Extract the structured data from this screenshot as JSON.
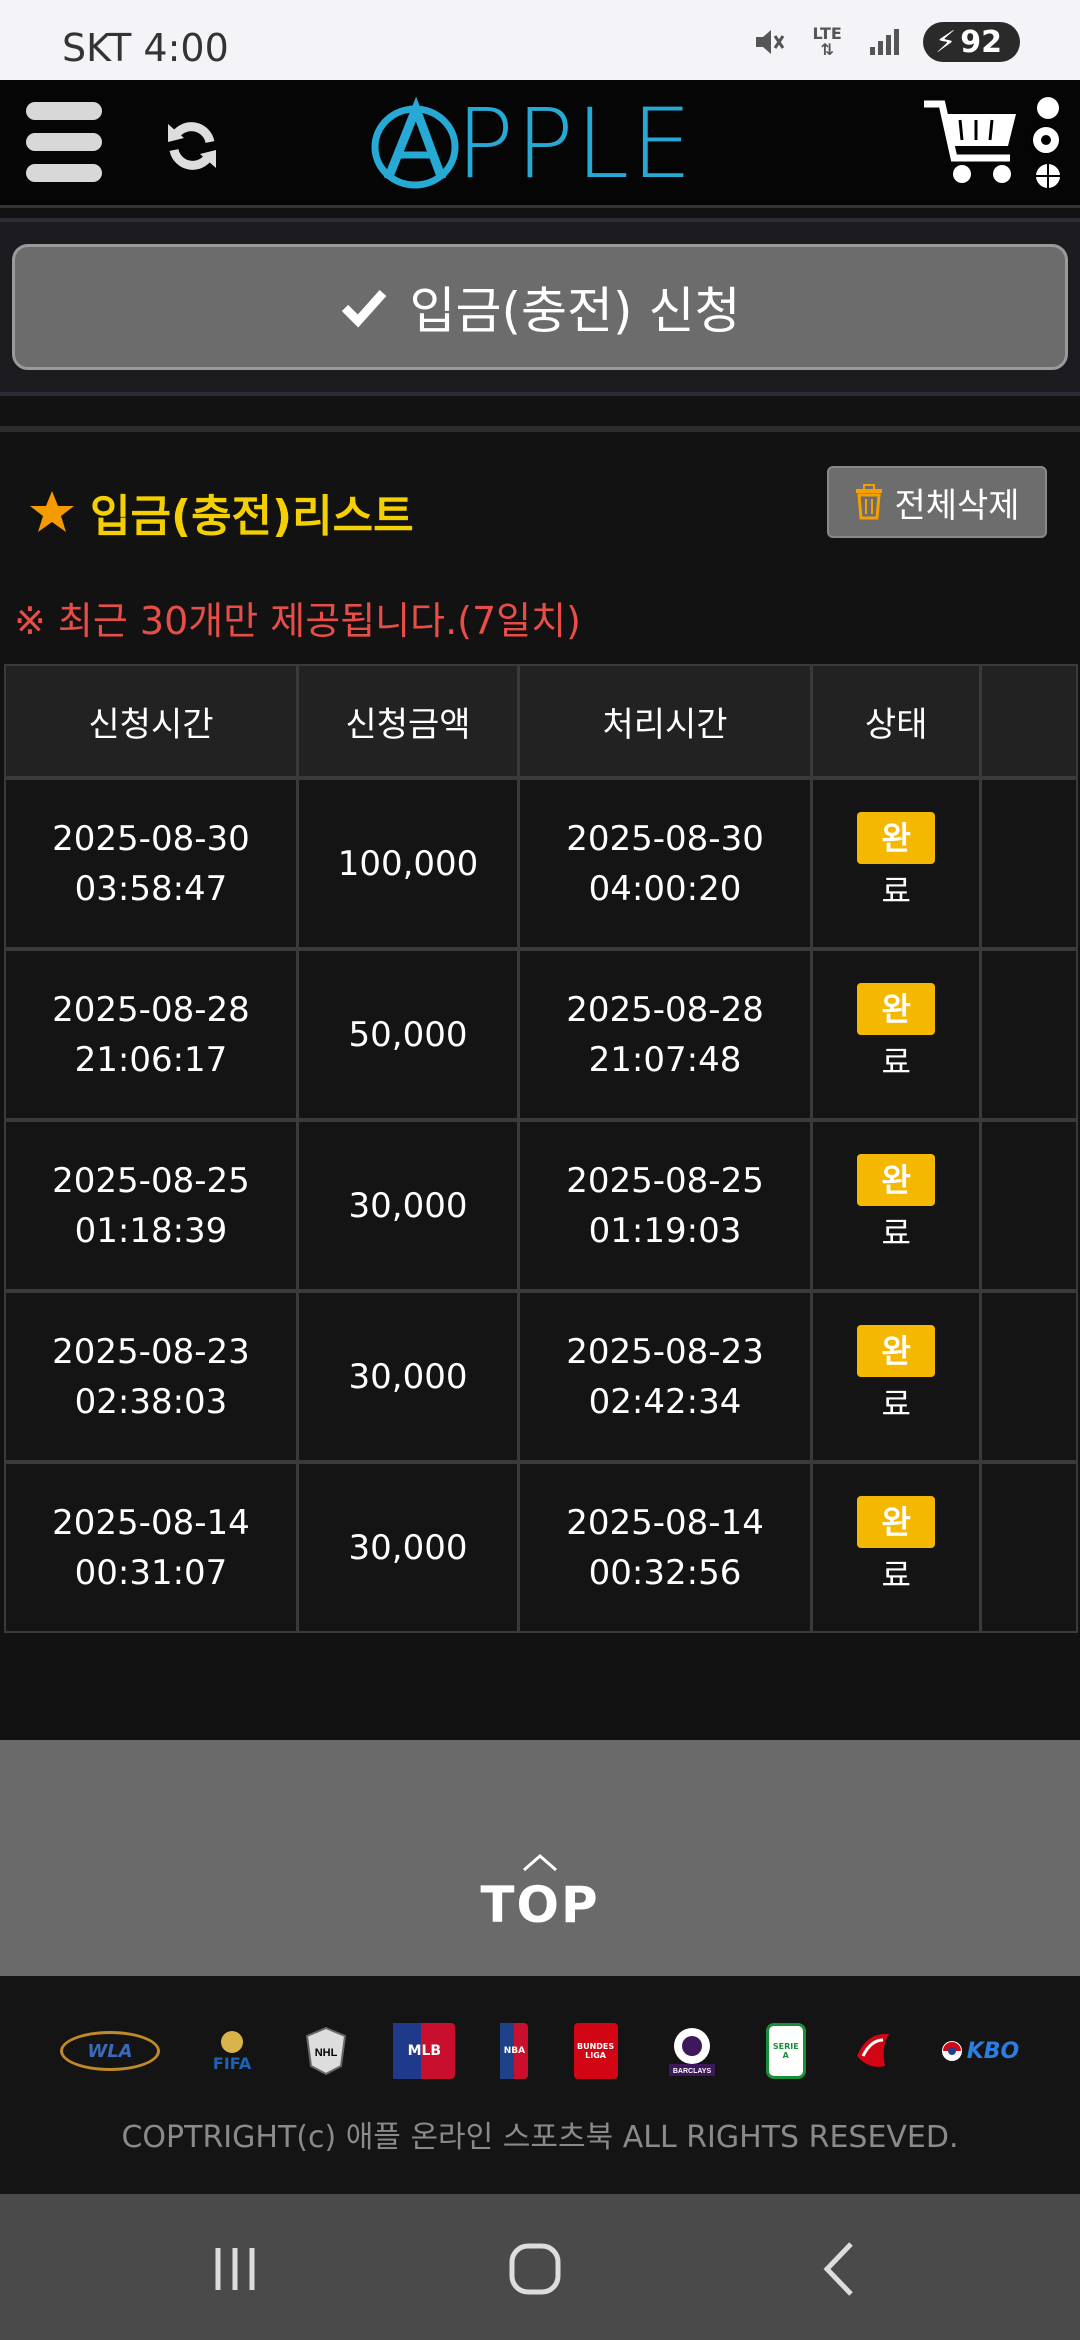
{
  "status_bar": {
    "carrier": "SKT",
    "time": "4:00",
    "network": "LTE",
    "battery": "92"
  },
  "header": {
    "logo_text": "PPLE"
  },
  "apply": {
    "label": "입금(충전) 신청"
  },
  "list": {
    "title": "입금(충전)리스트",
    "delete_all": "전체삭제",
    "notice": "※ 최근 30개만 제공됩니다.(7일치)",
    "columns": [
      "신청시간",
      "신청금액",
      "처리시간",
      "상태",
      ""
    ],
    "rows": [
      {
        "req_date": "2025-08-30",
        "req_time": "03:58:47",
        "amount": "100,000",
        "proc_date": "2025-08-30",
        "proc_time": "04:00:20",
        "status_1": "완",
        "status_2": "료"
      },
      {
        "req_date": "2025-08-28",
        "req_time": "21:06:17",
        "amount": "50,000",
        "proc_date": "2025-08-28",
        "proc_time": "21:07:48",
        "status_1": "완",
        "status_2": "료"
      },
      {
        "req_date": "2025-08-25",
        "req_time": "01:18:39",
        "amount": "30,000",
        "proc_date": "2025-08-25",
        "proc_time": "01:19:03",
        "status_1": "완",
        "status_2": "료"
      },
      {
        "req_date": "2025-08-23",
        "req_time": "02:38:03",
        "amount": "30,000",
        "proc_date": "2025-08-23",
        "proc_time": "02:42:34",
        "status_1": "완",
        "status_2": "료"
      },
      {
        "req_date": "2025-08-14",
        "req_time": "00:31:07",
        "amount": "30,000",
        "proc_date": "2025-08-14",
        "proc_time": "00:32:56",
        "status_1": "완",
        "status_2": "료"
      }
    ]
  },
  "top_button": {
    "label": "TOP"
  },
  "footer": {
    "logos": [
      "WLA",
      "FIFA",
      "NHL",
      "MLB",
      "NBA",
      "BUNDES LIGA",
      "BARCLAYS",
      "SERIE A",
      "KBO"
    ],
    "copyright": "COPTRIGHT(c) 애플 온라인 스포츠북 ALL RIGHTS RESEVED."
  },
  "colors": {
    "accent_yellow": "#f5d000",
    "logo_blue": "#27a9d6",
    "notice_red": "#e84e47",
    "badge": "#f5b800"
  }
}
